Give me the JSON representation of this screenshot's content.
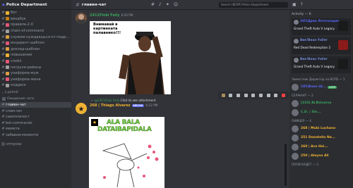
{
  "server": {
    "name": "Police Department"
  },
  "channels": [
    {
      "icon": "#",
      "label": "бот",
      "color": "#949ba4"
    },
    {
      "icon": "#",
      "label": "вендбук",
      "color": "#949ba4"
    },
    {
      "icon": "#",
      "label": "правила-2-0",
      "color": "#949ba4"
    },
    {
      "icon": "#",
      "label": "chain-of-command",
      "color": "#949ba4"
    },
    {
      "icon": "#",
      "label": "служим-нуждаешься-от-подр...",
      "color": "#949ba4"
    },
    {
      "icon": "#",
      "label": "инцидент-шаблон",
      "color": "#949ba4"
    },
    {
      "icon": "#",
      "label": "доклад-шаблон",
      "color": "#949ba4"
    },
    {
      "icon": "#",
      "label": "повышение",
      "color": "#949ba4"
    },
    {
      "icon": "#",
      "label": "спойл",
      "color": "#949ba4"
    },
    {
      "icon": "#",
      "label": "патрули-районы",
      "color": "#949ba4"
    },
    {
      "icon": "#",
      "label": "униформа-муж",
      "color": "#949ba4"
    },
    {
      "icon": "#",
      "label": "униформа-жена",
      "color": "#949ba4"
    },
    {
      "icon": "#",
      "label": "коддеск",
      "color": "#949ba4"
    }
  ],
  "category_permit": "L-permit",
  "category_general": "Ожидание чата",
  "channels2": [
    {
      "icon": "#",
      "label": "главен-чат",
      "active": true
    },
    {
      "icon": "#",
      "label": "спам-чат",
      "active": false
    },
    {
      "icon": "#",
      "label": "самоплачост",
      "active": false
    },
    {
      "icon": "#",
      "label": "bot-commands",
      "active": false
    },
    {
      "icon": "#",
      "label": "мемета",
      "active": false
    },
    {
      "icon": "#",
      "label": "забавни-моменти",
      "active": false
    }
  ],
  "bottom_channel": "отпуски",
  "topbar": {
    "channel": "главен-чат"
  },
  "search": {
    "placeholder": "Search [BCRP] Police Department"
  },
  "messages": [
    {
      "author": "2411Floki Felly",
      "time": "6:20 PM",
      "image_text": "Внимавай в картинката палавнико!!!",
      "author_color": "#3ba55d"
    },
    {
      "reply_mention": "@2411Floki Felly",
      "reply_text": "Click to see attachment",
      "author": "268 | Thiago Alvarez",
      "badge": "MECHS",
      "time": "6:22 PM",
      "image_line1": "ALA BALA",
      "image_line2": "DATAIBAPIDALA",
      "author_color": "#f0b232"
    }
  ],
  "activity": {
    "header": "Activity — 6",
    "cards": [
      {
        "name": "26f1Дрия Летечкадин",
        "game": "Grand Theft Auto V Legacy",
        "name_color": "#5865f2",
        "game_color": "#1a1a1a"
      },
      {
        "name": "Вик!Ваан Уаllег",
        "game": "Red Dead Redemption 2",
        "name_color": "#7289da",
        "game_color": "#8b1a1a"
      },
      {
        "name": "Вик!Ваан Уаllег",
        "game": "Grand Theft Auto V Legacy",
        "name_color": "#7289da",
        "game_color": "#1a1a1a"
      }
    ]
  },
  "roles": [
    {
      "label": "Заместник Директор на ВСРD — 1",
      "members": [
        {
          "name": "105|Ваан Ш...",
          "color": "#5865f2",
          "tag": "LAPD"
        }
      ]
    },
    {
      "label": "СЕРЖАНТ — 2",
      "members": [
        {
          "name": "[333] Al.Bsivaros",
          "color": "#3ba55d",
          "tag": ""
        },
        {
          "name": "C.D. | Sin...",
          "color": "#3ba55d",
          "tag": ""
        }
      ]
    },
    {
      "label": "ОФИЦЕР — 4",
      "members": [
        {
          "name": "268 | Muki Luchano",
          "color": "#f0b232",
          "tag": ""
        },
        {
          "name": "251 Donatello Ne...",
          "color": "#f0b232",
          "tag": ""
        },
        {
          "name": "260 | Ace Hei...",
          "color": "#f0b232",
          "tag": ""
        },
        {
          "name": "250 | Aleyna Ali",
          "color": "#f0b232",
          "tag": ""
        }
      ]
    }
  ],
  "bottom_role": "ПОЛИ КАДЕТ — 3",
  "colors": {
    "bg": "#313338",
    "sidebar": "#2b2d31",
    "accent": "#5865f2"
  }
}
